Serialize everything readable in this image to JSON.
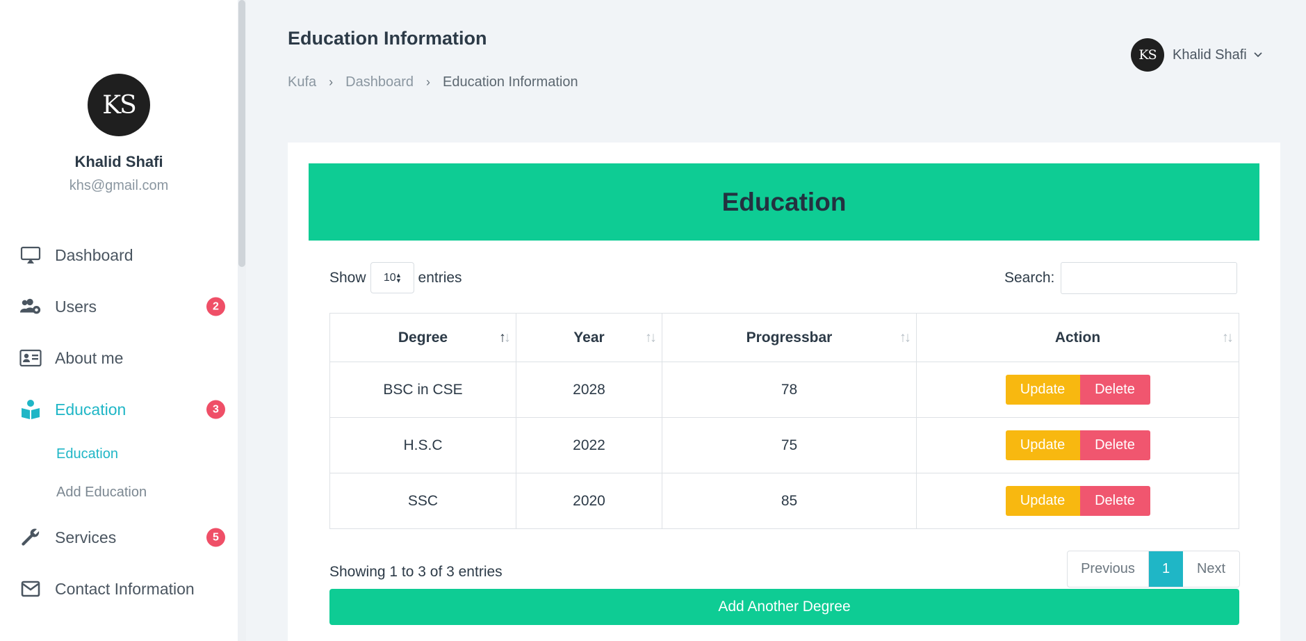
{
  "profile": {
    "avatar_text": "KS",
    "name": "Khalid Shafi",
    "email": "khs@gmail.com"
  },
  "nav": {
    "dashboard": {
      "label": "Dashboard",
      "icon": "monitor-icon"
    },
    "users": {
      "label": "Users",
      "icon": "users-gear-icon",
      "badge": "2"
    },
    "about": {
      "label": "About me",
      "icon": "id-card-icon"
    },
    "education": {
      "label": "Education",
      "icon": "book-reader-icon",
      "badge": "3"
    },
    "education_sub": {
      "education": "Education",
      "add_education": "Add Education"
    },
    "services": {
      "label": "Services",
      "icon": "wrench-icon",
      "badge": "5"
    },
    "contact": {
      "label": "Contact Information",
      "icon": "envelope-icon"
    }
  },
  "header": {
    "title": "Education Information",
    "breadcrumb": [
      "Kufa",
      "Dashboard",
      "Education Information"
    ],
    "user_name": "Khalid Shafi",
    "avatar_text": "KS"
  },
  "card": {
    "title": "Education",
    "show_label": "Show",
    "entries_label": "entries",
    "page_size": "10",
    "search_label": "Search:",
    "search_value": ""
  },
  "table": {
    "columns": [
      "Degree",
      "Year",
      "Progressbar",
      "Action"
    ],
    "rows": [
      {
        "degree": "BSC in CSE",
        "year": "2028",
        "progress": "78"
      },
      {
        "degree": "H.S.C",
        "year": "2022",
        "progress": "75"
      },
      {
        "degree": "SSC",
        "year": "2020",
        "progress": "85"
      }
    ],
    "update_label": "Update",
    "delete_label": "Delete"
  },
  "footer": {
    "showing": "Showing 1 to 3 of 3 entries",
    "prev": "Previous",
    "page": "1",
    "next": "Next",
    "add_button": "Add Another Degree"
  },
  "colors": {
    "accent": "#1fb6c6",
    "header_green": "#0ecc94",
    "update": "#f8b810",
    "delete": "#f0566f",
    "badge": "#ef4f67"
  }
}
